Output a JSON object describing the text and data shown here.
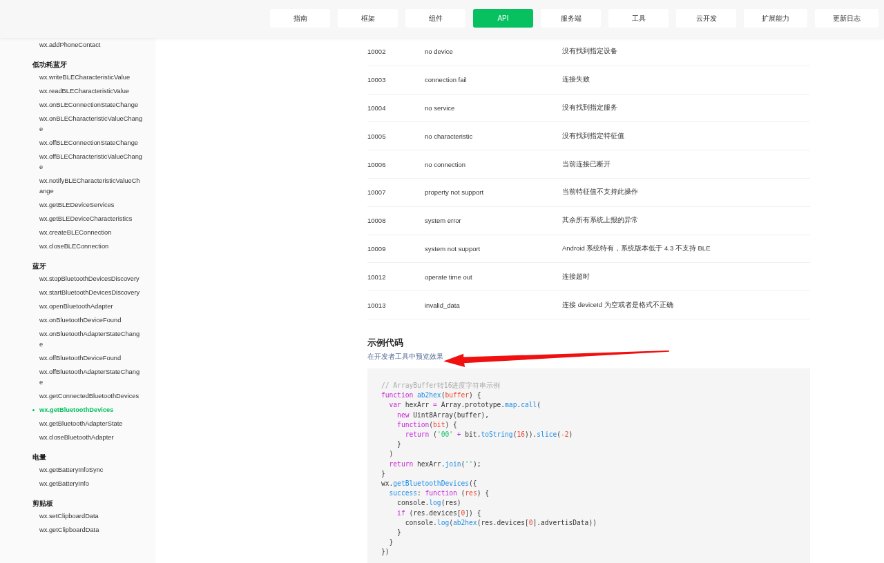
{
  "nav": [
    {
      "label": "指南",
      "selected": false
    },
    {
      "label": "框架",
      "selected": false
    },
    {
      "label": "组件",
      "selected": false
    },
    {
      "label": "API",
      "selected": true
    },
    {
      "label": "服务端",
      "selected": false
    },
    {
      "label": "工具",
      "selected": false
    },
    {
      "label": "云开发",
      "selected": false
    },
    {
      "label": "扩展能力",
      "selected": false
    },
    {
      "label": "更新日志",
      "selected": false
    }
  ],
  "sidebar": {
    "groups": [
      {
        "items": [
          {
            "label": "wx.addPhoneContact",
            "selected": false
          }
        ]
      },
      {
        "title": "低功耗蓝牙",
        "items": [
          {
            "label": "wx.writeBLECharacteristicValue",
            "selected": false
          },
          {
            "label": "wx.readBLECharacteristicValue",
            "selected": false
          },
          {
            "label": "wx.onBLEConnectionStateChange",
            "selected": false
          },
          {
            "label": "wx.onBLECharacteristicValueChange",
            "selected": false
          },
          {
            "label": "wx.offBLEConnectionStateChange",
            "selected": false
          },
          {
            "label": "wx.offBLECharacteristicValueChange",
            "selected": false
          },
          {
            "label": "wx.notifyBLECharacteristicValueChange",
            "selected": false
          },
          {
            "label": "wx.getBLEDeviceServices",
            "selected": false
          },
          {
            "label": "wx.getBLEDeviceCharacteristics",
            "selected": false
          },
          {
            "label": "wx.createBLEConnection",
            "selected": false
          },
          {
            "label": "wx.closeBLEConnection",
            "selected": false
          }
        ]
      },
      {
        "title": "蓝牙",
        "items": [
          {
            "label": "wx.stopBluetoothDevicesDiscovery",
            "selected": false
          },
          {
            "label": "wx.startBluetoothDevicesDiscovery",
            "selected": false
          },
          {
            "label": "wx.openBluetoothAdapter",
            "selected": false
          },
          {
            "label": "wx.onBluetoothDeviceFound",
            "selected": false
          },
          {
            "label": "wx.onBluetoothAdapterStateChange",
            "selected": false
          },
          {
            "label": "wx.offBluetoothDeviceFound",
            "selected": false
          },
          {
            "label": "wx.offBluetoothAdapterStateChange",
            "selected": false
          },
          {
            "label": "wx.getConnectedBluetoothDevices",
            "selected": false
          },
          {
            "label": "wx.getBluetoothDevices",
            "selected": true
          },
          {
            "label": "wx.getBluetoothAdapterState",
            "selected": false
          },
          {
            "label": "wx.closeBluetoothAdapter",
            "selected": false
          }
        ]
      },
      {
        "title": "电量",
        "items": [
          {
            "label": "wx.getBatteryInfoSync",
            "selected": false
          },
          {
            "label": "wx.getBatteryInfo",
            "selected": false
          }
        ]
      },
      {
        "title": "剪贴板",
        "items": [
          {
            "label": "wx.setClipboardData",
            "selected": false
          },
          {
            "label": "wx.getClipboardData",
            "selected": false
          }
        ]
      }
    ]
  },
  "error_table": {
    "rows": [
      [
        "10002",
        "no device",
        "没有找到指定设备"
      ],
      [
        "10003",
        "connection fail",
        "连接失败"
      ],
      [
        "10004",
        "no service",
        "没有找到指定服务"
      ],
      [
        "10005",
        "no characteristic",
        "没有找到指定特征值"
      ],
      [
        "10006",
        "no connection",
        "当前连接已断开"
      ],
      [
        "10007",
        "property not support",
        "当前特征值不支持此操作"
      ],
      [
        "10008",
        "system error",
        "其余所有系统上报的异常"
      ],
      [
        "10009",
        "system not support",
        "Android 系统特有，系统版本低于 4.3 不支持 BLE"
      ],
      [
        "10012",
        "operate time out",
        "连接超时"
      ],
      [
        "10013",
        "invalid_data",
        "连接 deviceId 为空或者是格式不正确"
      ]
    ]
  },
  "example": {
    "heading": "示例代码",
    "preview_link": "在开发者工具中预览效果",
    "code_lines": [
      [
        {
          "kind": "comment",
          "text": "// ArrayBuffer转16进度字符串示例"
        }
      ],
      [
        {
          "kind": "keyword",
          "text": "function"
        },
        {
          "kind": "func",
          "text": " ab2hex"
        },
        {
          "kind": "plain",
          "text": "("
        },
        {
          "kind": "param",
          "text": "buffer"
        },
        {
          "kind": "plain",
          "text": ") {"
        }
      ],
      [
        {
          "kind": "keyword",
          "text": "  var"
        },
        {
          "kind": "plain",
          "text": " hexArr "
        },
        {
          "kind": "keyword",
          "text": "="
        },
        {
          "kind": "plain",
          "text": " Array.prototype."
        },
        {
          "kind": "func",
          "text": "map"
        },
        {
          "kind": "plain",
          "text": "."
        },
        {
          "kind": "func",
          "text": "call"
        },
        {
          "kind": "plain",
          "text": "("
        }
      ],
      [
        {
          "kind": "keyword",
          "text": "    new"
        },
        {
          "kind": "plain",
          "text": " Uint8Array(buffer),"
        }
      ],
      [
        {
          "kind": "keyword",
          "text": "    function"
        },
        {
          "kind": "plain",
          "text": "("
        },
        {
          "kind": "param",
          "text": "bit"
        },
        {
          "kind": "plain",
          "text": ") {"
        }
      ],
      [
        {
          "kind": "keyword",
          "text": "      return"
        },
        {
          "kind": "plain",
          "text": " ("
        },
        {
          "kind": "string",
          "text": "'00'"
        },
        {
          "kind": "keyword",
          "text": " +"
        },
        {
          "kind": "plain",
          "text": " bit."
        },
        {
          "kind": "func",
          "text": "toString"
        },
        {
          "kind": "plain",
          "text": "("
        },
        {
          "kind": "number",
          "text": "16"
        },
        {
          "kind": "plain",
          "text": "))."
        },
        {
          "kind": "func",
          "text": "slice"
        },
        {
          "kind": "plain",
          "text": "("
        },
        {
          "kind": "number",
          "text": "-2"
        },
        {
          "kind": "plain",
          "text": ")"
        }
      ],
      [
        {
          "kind": "plain",
          "text": "    }"
        }
      ],
      [
        {
          "kind": "plain",
          "text": "  )"
        }
      ],
      [
        {
          "kind": "keyword",
          "text": "  return"
        },
        {
          "kind": "plain",
          "text": " hexArr."
        },
        {
          "kind": "func",
          "text": "join"
        },
        {
          "kind": "plain",
          "text": "("
        },
        {
          "kind": "string",
          "text": "''"
        },
        {
          "kind": "plain",
          "text": ");"
        }
      ],
      [
        {
          "kind": "plain",
          "text": "}"
        }
      ],
      [
        {
          "kind": "plain",
          "text": "wx."
        },
        {
          "kind": "func",
          "text": "getBluetoothDevices"
        },
        {
          "kind": "plain",
          "text": "({"
        }
      ],
      [
        {
          "kind": "func",
          "text": "  success"
        },
        {
          "kind": "plain",
          "text": ": "
        },
        {
          "kind": "keyword",
          "text": "function"
        },
        {
          "kind": "plain",
          "text": " ("
        },
        {
          "kind": "param",
          "text": "res"
        },
        {
          "kind": "plain",
          "text": ") {"
        }
      ],
      [
        {
          "kind": "plain",
          "text": "    console."
        },
        {
          "kind": "func",
          "text": "log"
        },
        {
          "kind": "plain",
          "text": "(res)"
        }
      ],
      [
        {
          "kind": "keyword",
          "text": "    if"
        },
        {
          "kind": "plain",
          "text": " (res.devices["
        },
        {
          "kind": "number",
          "text": "0"
        },
        {
          "kind": "plain",
          "text": "]) {"
        }
      ],
      [
        {
          "kind": "plain",
          "text": "      console."
        },
        {
          "kind": "func",
          "text": "log"
        },
        {
          "kind": "plain",
          "text": "("
        },
        {
          "kind": "func",
          "text": "ab2hex"
        },
        {
          "kind": "plain",
          "text": "(res.devices["
        },
        {
          "kind": "number",
          "text": "0"
        },
        {
          "kind": "plain",
          "text": "].advertisData))"
        }
      ],
      [
        {
          "kind": "plain",
          "text": "    }"
        }
      ],
      [
        {
          "kind": "plain",
          "text": "  }"
        }
      ],
      [
        {
          "kind": "plain",
          "text": "})"
        }
      ]
    ]
  }
}
